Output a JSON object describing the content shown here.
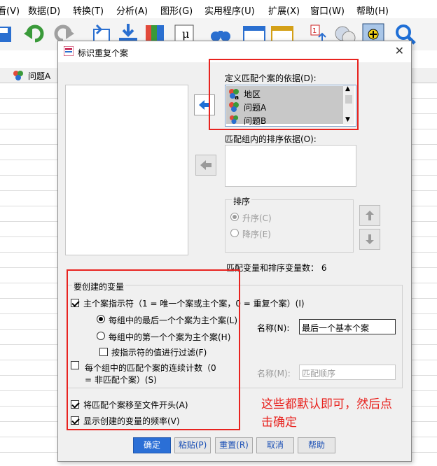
{
  "menu": [
    "看(V)",
    "数据(D)",
    "转换(T)",
    "分析(A)",
    "图形(G)",
    "实用程序(U)",
    "扩展(X)",
    "窗口(W)",
    "帮助(H)"
  ],
  "sheet": {
    "column_header": "问题A"
  },
  "dialog": {
    "title": "标识重复个案",
    "match_label": "定义匹配个案的依据(D):",
    "match_vars": [
      "地区",
      "问题A",
      "问题B"
    ],
    "sort_within_label": "匹配组内的排序依据(O):",
    "sort_title": "排序",
    "ascending": "升序(C)",
    "descending": "降序(E)",
    "count_text": "匹配变量和排序变量数：  6",
    "create_title": "要创建的变量",
    "primary_indicator": "主个案指示符（1 = 唯一个案或主个案，0 = 重复个案）(I)",
    "last_case": "每组中的最后一个个案为主个案(L)",
    "first_case": "每组中的第一个个案为主个案(H)",
    "filter_by_indicator": "按指示符的值进行过滤(F)",
    "name1_label": "名称(N):",
    "name1_value": "最后一个基本个案",
    "sequential_count_line1": "每个组中的匹配个案的连续计数（0",
    "sequential_count_line2": "= 非匹配个案）(S)",
    "name2_label": "名称(M):",
    "name2_value": "匹配顺序",
    "move_to_top": "将匹配个案移至文件开头(A)",
    "show_frequencies": "显示创建的变量的频率(V)",
    "buttons": {
      "ok": "确定",
      "paste": "粘贴(P)",
      "reset": "重置(R)",
      "cancel": "取消",
      "help": "帮助"
    }
  },
  "annotation": {
    "line1": "这些都默认即可，然后点",
    "line2": "击确定"
  },
  "colors": {
    "accent": "#2b6fd6",
    "annotation": "#e8231f"
  }
}
